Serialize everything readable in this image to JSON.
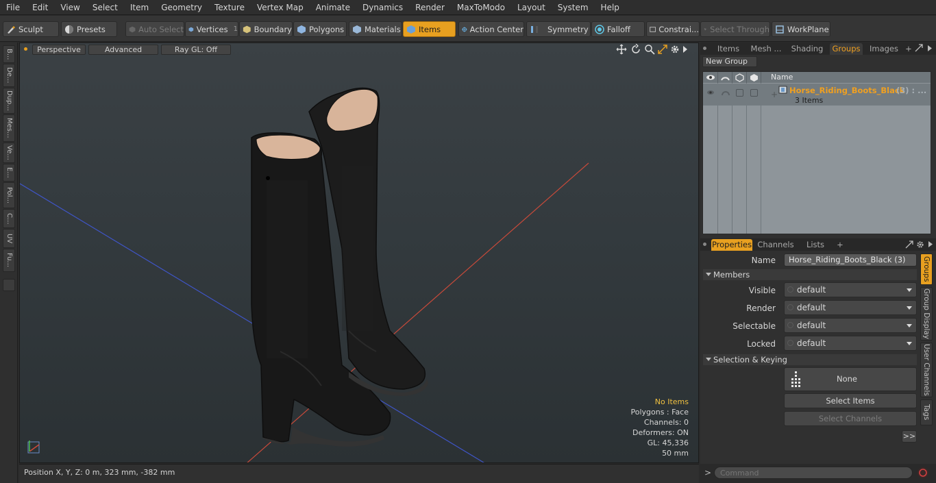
{
  "menu": [
    "File",
    "Edit",
    "View",
    "Select",
    "Item",
    "Geometry",
    "Texture",
    "Vertex Map",
    "Animate",
    "Dynamics",
    "Render",
    "MaxToModo",
    "Layout",
    "System",
    "Help"
  ],
  "toolbar": {
    "sculpt": "Sculpt",
    "presets": "Presets",
    "auto_select": "Auto Select",
    "vertices": "Vertices",
    "vertices_count": "1",
    "boundary": "Boundary",
    "polygons": "Polygons",
    "materials": "Materials",
    "items": "Items",
    "action_center": "Action Center",
    "symmetry": "Symmetry",
    "falloff": "Falloff",
    "constraints": "Constrai...",
    "select_through": "Select Through",
    "workplane": "WorkPlane"
  },
  "left_tabs": [
    "B...",
    "De...",
    "Dup...",
    "Mes...",
    "Ve...",
    "E...",
    "Pol...",
    "C...",
    "UV",
    "Fu..."
  ],
  "viewport": {
    "view_mode": "Perspective",
    "shading": "Advanced",
    "raygl": "Ray GL: Off",
    "info": {
      "selection": "No Items",
      "polygons": "Polygons : Face",
      "channels": "Channels: 0",
      "deformers": "Deformers: ON",
      "gl": "GL: 45,336",
      "units": "50 mm"
    }
  },
  "status": {
    "position": "Position X, Y, Z:   0 m, 323 mm, -382 mm"
  },
  "top_panel": {
    "tabs": [
      "Items",
      "Mesh ...",
      "Shading",
      "Groups",
      "Images"
    ],
    "new_group": "New Group",
    "name_header": "Name",
    "group_name": "Horse_Riding_Boots_Black",
    "group_count": "(3) : ...",
    "group_items": "3 Items"
  },
  "props_panel": {
    "tabs": [
      "Properties",
      "Channels",
      "Lists"
    ],
    "name_label": "Name",
    "name_value": "Horse_Riding_Boots_Black (3)",
    "members_header": "Members",
    "visible_label": "Visible",
    "visible_value": "default",
    "render_label": "Render",
    "render_value": "default",
    "selectable_label": "Selectable",
    "selectable_value": "default",
    "locked_label": "Locked",
    "locked_value": "default",
    "sel_keying_header": "Selection & Keying",
    "none_label": "None",
    "select_items": "Select Items",
    "select_channels": "Select Channels",
    "more": ">>"
  },
  "right_vtabs": [
    "Groups",
    "Group Display",
    "User Channels",
    "Tags"
  ],
  "command_placeholder": "Command",
  "colors": {
    "accent": "#e8a020",
    "group_name": "#f0a020"
  }
}
